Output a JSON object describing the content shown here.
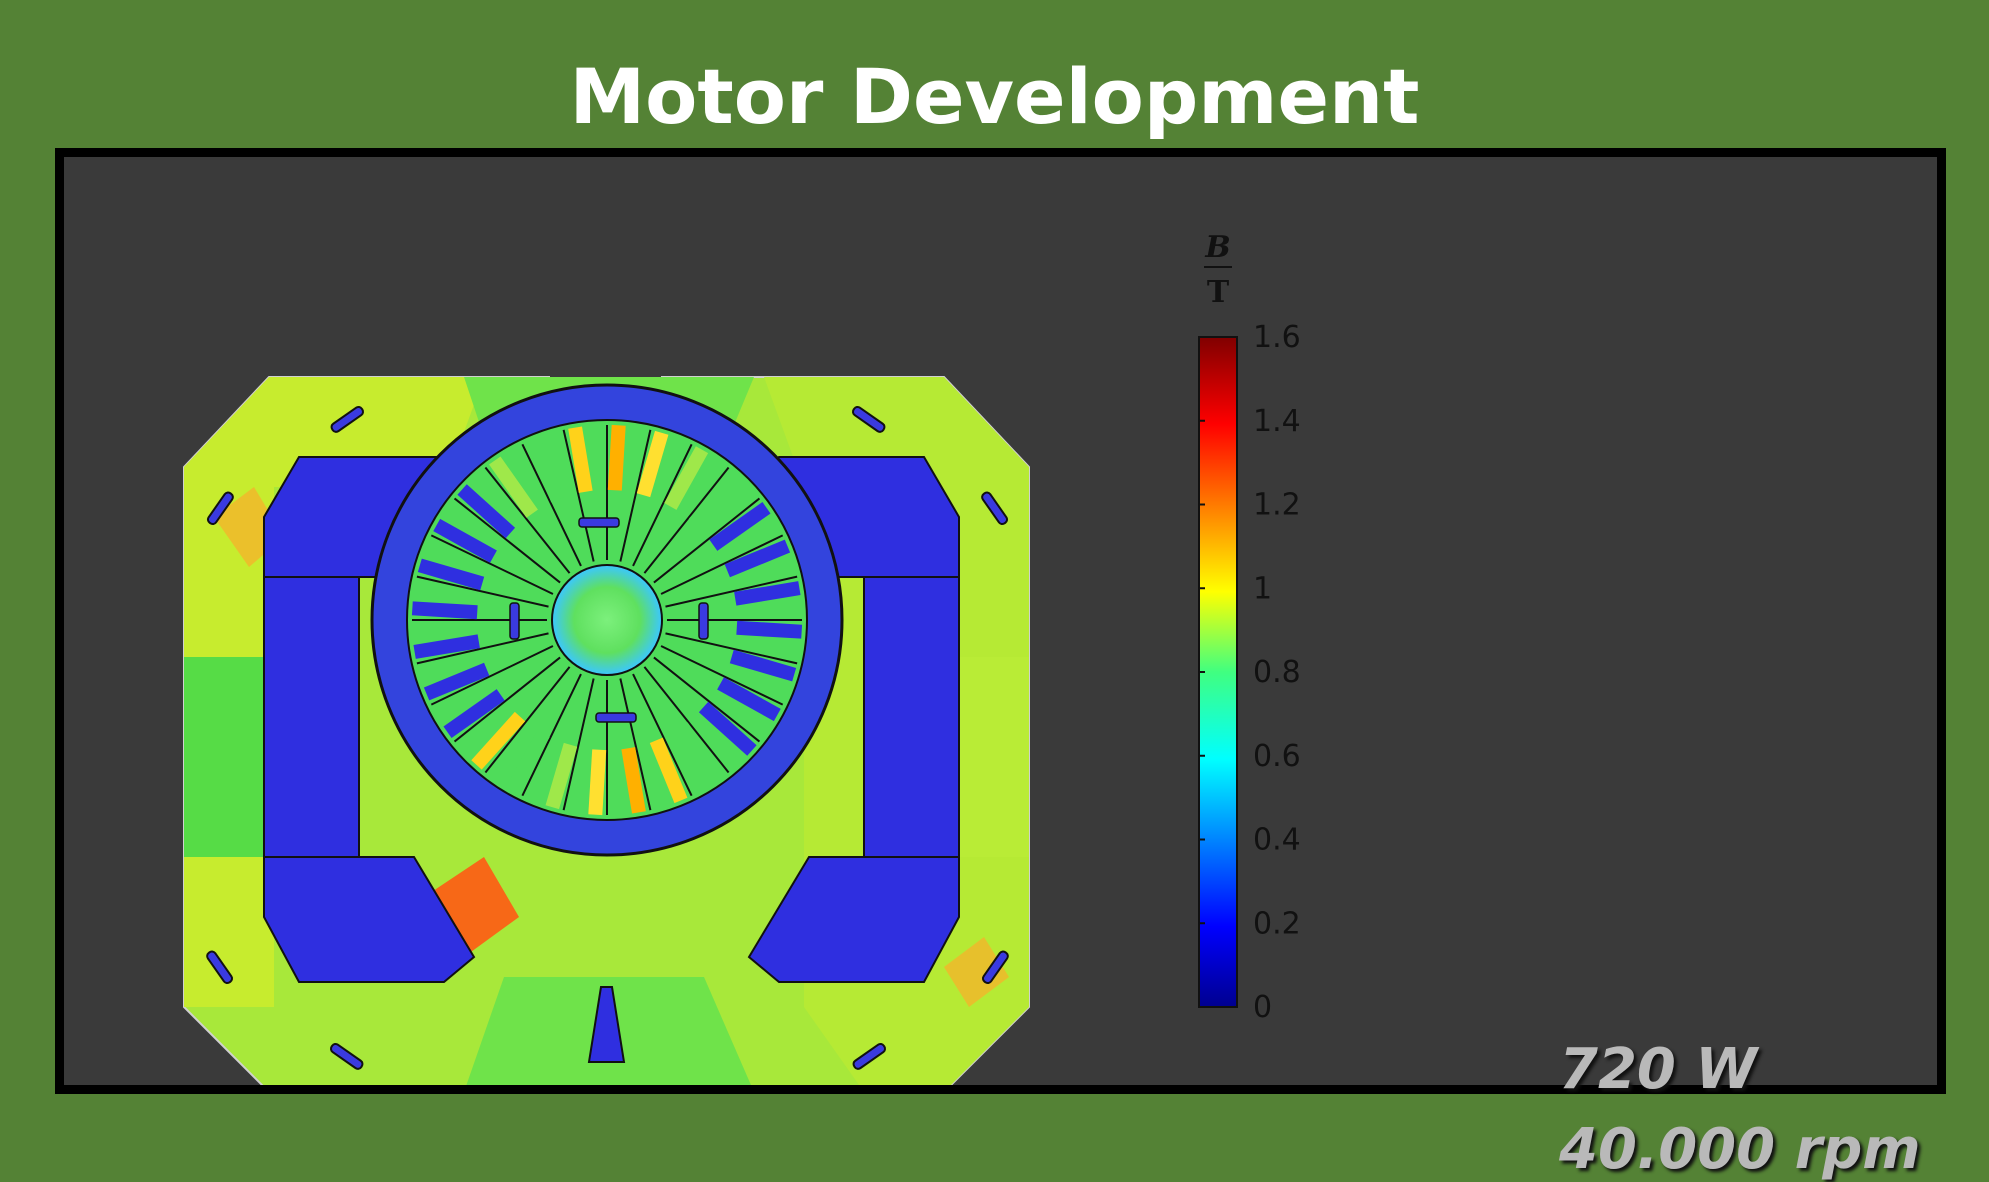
{
  "slide": {
    "title": "Motor Development"
  },
  "colorbar": {
    "quantity_top": "B",
    "quantity_bottom": "T",
    "min": 0,
    "max": 1.6,
    "tick_labels": [
      "1.6",
      "1.4",
      "1.2",
      "1",
      "0.8",
      "0.6",
      "0.4",
      "0.2",
      "0"
    ]
  },
  "stats": {
    "power": "720 W",
    "speed": "40.000 rpm"
  },
  "colors": {
    "background": "#548235",
    "panel": "#3a3a3a",
    "field_low": "#2b2bd6",
    "field_high": "#b00000"
  }
}
